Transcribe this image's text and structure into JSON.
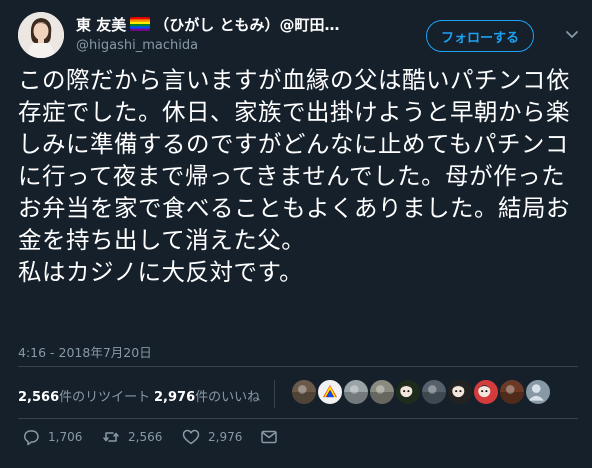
{
  "user": {
    "display_name": "東 友美 🏳️‍🌈（ひがし ともみ）@町田…",
    "handle": "@higashi_machida",
    "rainbow_flag": [
      "#e40303",
      "#ff8c00",
      "#ffed00",
      "#008026",
      "#004dff",
      "#750787"
    ]
  },
  "follow_button": {
    "label": "フォローする"
  },
  "tweet_text": "この際だから言いますが血縁の父は酷いパチンコ依存症でした。休日、家族で出掛けようと早朝から楽しみに準備するのですがどんなに止めてもパチンコに行って夜まで帰ってきませんでした。母が作ったお弁当を家で食べることもよくありました。結局お金を持ち出して消えた父。\n私はカジノに大反対です。",
  "timestamp": "4:16 - 2018年7月20日",
  "stats": {
    "retweets_count": "2,566",
    "retweets_label": "件のリツイート",
    "likes_count": "2,976",
    "likes_label": "件のいいね"
  },
  "liker_avatars": [
    {
      "color": "#6b5a4a",
      "icon": "avatar-photo"
    },
    {
      "color": "#f2f2f2",
      "icon": "avatar-rainbow"
    },
    {
      "color": "#9aa3a8",
      "icon": "avatar-photo"
    },
    {
      "color": "#8a8a80",
      "icon": "avatar-photo"
    },
    {
      "color": "#1d2b1d",
      "icon": "avatar-anime"
    },
    {
      "color": "#55606a",
      "icon": "avatar-photo"
    },
    {
      "color": "#222222",
      "icon": "avatar-anime"
    },
    {
      "color": "#d43b3b",
      "icon": "avatar-anime"
    },
    {
      "color": "#6b3a26",
      "icon": "avatar-photo"
    },
    {
      "color": "#8899a6",
      "icon": "default-avatar"
    }
  ],
  "actions": {
    "reply_count": "1,706",
    "retweet_count": "2,566",
    "like_count": "2,976"
  },
  "colors": {
    "background": "#15202b",
    "accent": "#1da1f2",
    "muted": "#8899a6",
    "divider": "#38444d"
  }
}
